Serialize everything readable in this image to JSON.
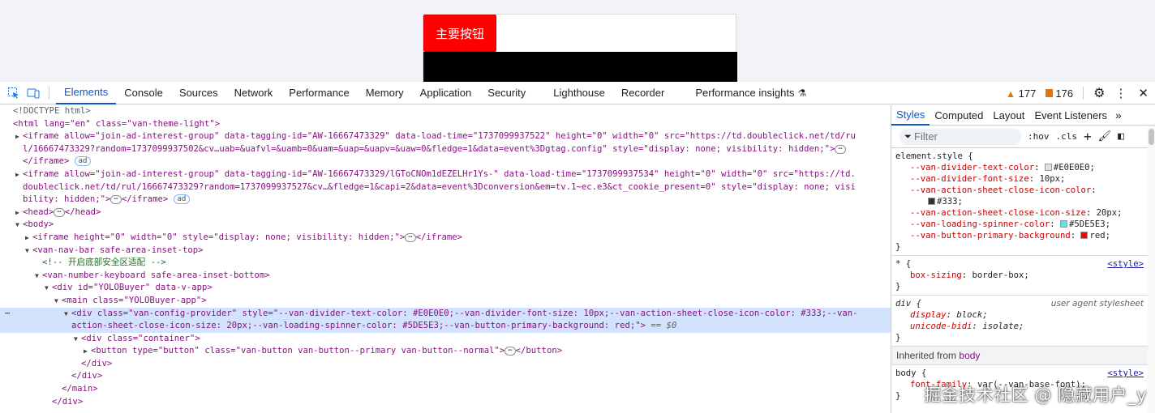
{
  "preview": {
    "primary_button": "主要按钮"
  },
  "toolbar": {
    "tabs": [
      "Elements",
      "Console",
      "Sources",
      "Network",
      "Performance",
      "Memory",
      "Application",
      "Security",
      "Lighthouse",
      "Recorder",
      "Performance insights"
    ],
    "warnings": "177",
    "issues": "176"
  },
  "tree": {
    "doctype": "<!DOCTYPE html>",
    "html_open": "<html lang=\"en\" class=\"van-theme-light\">",
    "iframe1_l1": "<iframe allow=\"join-ad-interest-group\" data-tagging-id=\"AW-16667473329\" data-load-time=\"1737099937522\" height=\"0\" width=\"0\" src=\"https://td.doubleclick.net/td/ru",
    "iframe1_l2": "l/16667473329?random=1737099937502&cv…uab=&uafvl=&uamb=0&uam=&uap=&uapv=&uaw=0&fledge=1&data=event%3Dgtag.config\" style=\"display: none; visibility: hidden;\">",
    "iframe1_close": "</iframe>",
    "iframe2_l1": "<iframe allow=\"join-ad-interest-group\" data-tagging-id=\"AW-16667473329/lGToCNOm1dEZELHr1Ys-\" data-load-time=\"1737099937534\" height=\"0\" width=\"0\" src=\"https://td.",
    "iframe2_l2": "doubleclick.net/td/rul/16667473329?random=1737099937527&cv…&fledge=1&capi=2&data=event%3Dconversion&em=tv.1~ec.e3&ct_cookie_present=0\" style=\"display: none; visi",
    "iframe2_l3": "bility: hidden;\">",
    "iframe2_close": "</iframe>",
    "ad_badge": "ad",
    "head": "<head>",
    "head_close": "</head>",
    "body_open": "<body>",
    "iframe3_open": "<iframe height=\"0\" width=\"0\" style=\"display: none; visibility: hidden;\">",
    "iframe3_close": "</iframe>",
    "navbar": "<van-nav-bar safe-area-inset-top>",
    "comment": "<!-- 开启底部安全区适配 -->",
    "keyboard": "<van-number-keyboard safe-area-inset-bottom>",
    "div_app": "<div id=\"YOLOBuyer\" data-v-app>",
    "main_open": "<main class=\"YOLOBuyer-app\">",
    "config_l1": "<div class=\"van-config-provider\" style=\"--van-divider-text-color: #E0E0E0;--van-divider-font-size: 10px;--van-action-sheet-close-icon-color: #333;--van-",
    "config_l2": "action-sheet-close-icon-size: 20px;--van-loading-spinner-color: #5DE5E3;--van-button-primary-background: red;\">",
    "eq0": "== $0",
    "container": "<div class=\"container\">",
    "button_open": "<button type=\"button\" class=\"van-button van-button--primary van-button--normal\">",
    "button_close": "</button>",
    "div_close": "</div>",
    "main_close": "</main>"
  },
  "styles": {
    "tabs": [
      "Styles",
      "Computed",
      "Layout",
      "Event Listeners"
    ],
    "filter_placeholder": "Filter",
    "hov": ":hov",
    "cls": ".cls",
    "element_style_selector": "element.style {",
    "element_style_props": [
      {
        "name": "--van-divider-text-color",
        "value": "#E0E0E0",
        "swatch": "#E0E0E0"
      },
      {
        "name": "--van-divider-font-size",
        "value": "10px"
      },
      {
        "name": "--van-action-sheet-close-icon-color",
        "value": "#333",
        "swatch": "#333333"
      },
      {
        "name": "--van-action-sheet-close-icon-size",
        "value": "20px"
      },
      {
        "name": "--van-loading-spinner-color",
        "value": "#5DE5E3",
        "swatch": "#5DE5E3"
      },
      {
        "name": "--van-button-primary-background",
        "value": "red",
        "swatch": "#ff0000"
      }
    ],
    "star_selector": "* {",
    "star_prop": "box-sizing",
    "star_value": "border-box",
    "style_link": "<style>",
    "div_selector": "div {",
    "ua_label": "user agent stylesheet",
    "div_prop1": "display",
    "div_val1": "block",
    "div_prop2": "unicode-bidi",
    "div_val2": "isolate",
    "inherited_label": "Inherited from",
    "inherited_tag": "body",
    "body_selector": "body {",
    "body_prop": "font-family",
    "body_value": "var(--van-base-font)",
    "close_brace": "}"
  },
  "watermark": "掘金技术社区 @ 隐藏用户_y"
}
